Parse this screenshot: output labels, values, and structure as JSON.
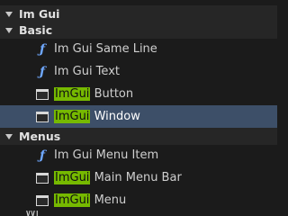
{
  "tree": {
    "root_label": "Im Gui",
    "basic": {
      "label": "Basic",
      "items": [
        {
          "icon": "function-icon",
          "label": "Im Gui Same Line"
        },
        {
          "icon": "function-icon",
          "label": "Im Gui Text"
        },
        {
          "icon": "node-icon",
          "highlight": "ImGui",
          "label": " Button"
        },
        {
          "icon": "node-icon",
          "highlight": "ImGui",
          "label": " Window",
          "selected": true
        }
      ]
    },
    "menus": {
      "label": "Menus",
      "items": [
        {
          "icon": "function-icon",
          "label": "Im Gui Menu Item"
        },
        {
          "icon": "node-icon",
          "highlight": "ImGui",
          "label": " Main Menu Bar"
        },
        {
          "icon": "node-icon",
          "highlight": "ImGui",
          "label": " Menu"
        }
      ]
    },
    "partial_next": "Wi"
  },
  "colors": {
    "selection": "#3d4f68",
    "highlight": "#76b900",
    "function_icon": "#6fa8ff"
  }
}
